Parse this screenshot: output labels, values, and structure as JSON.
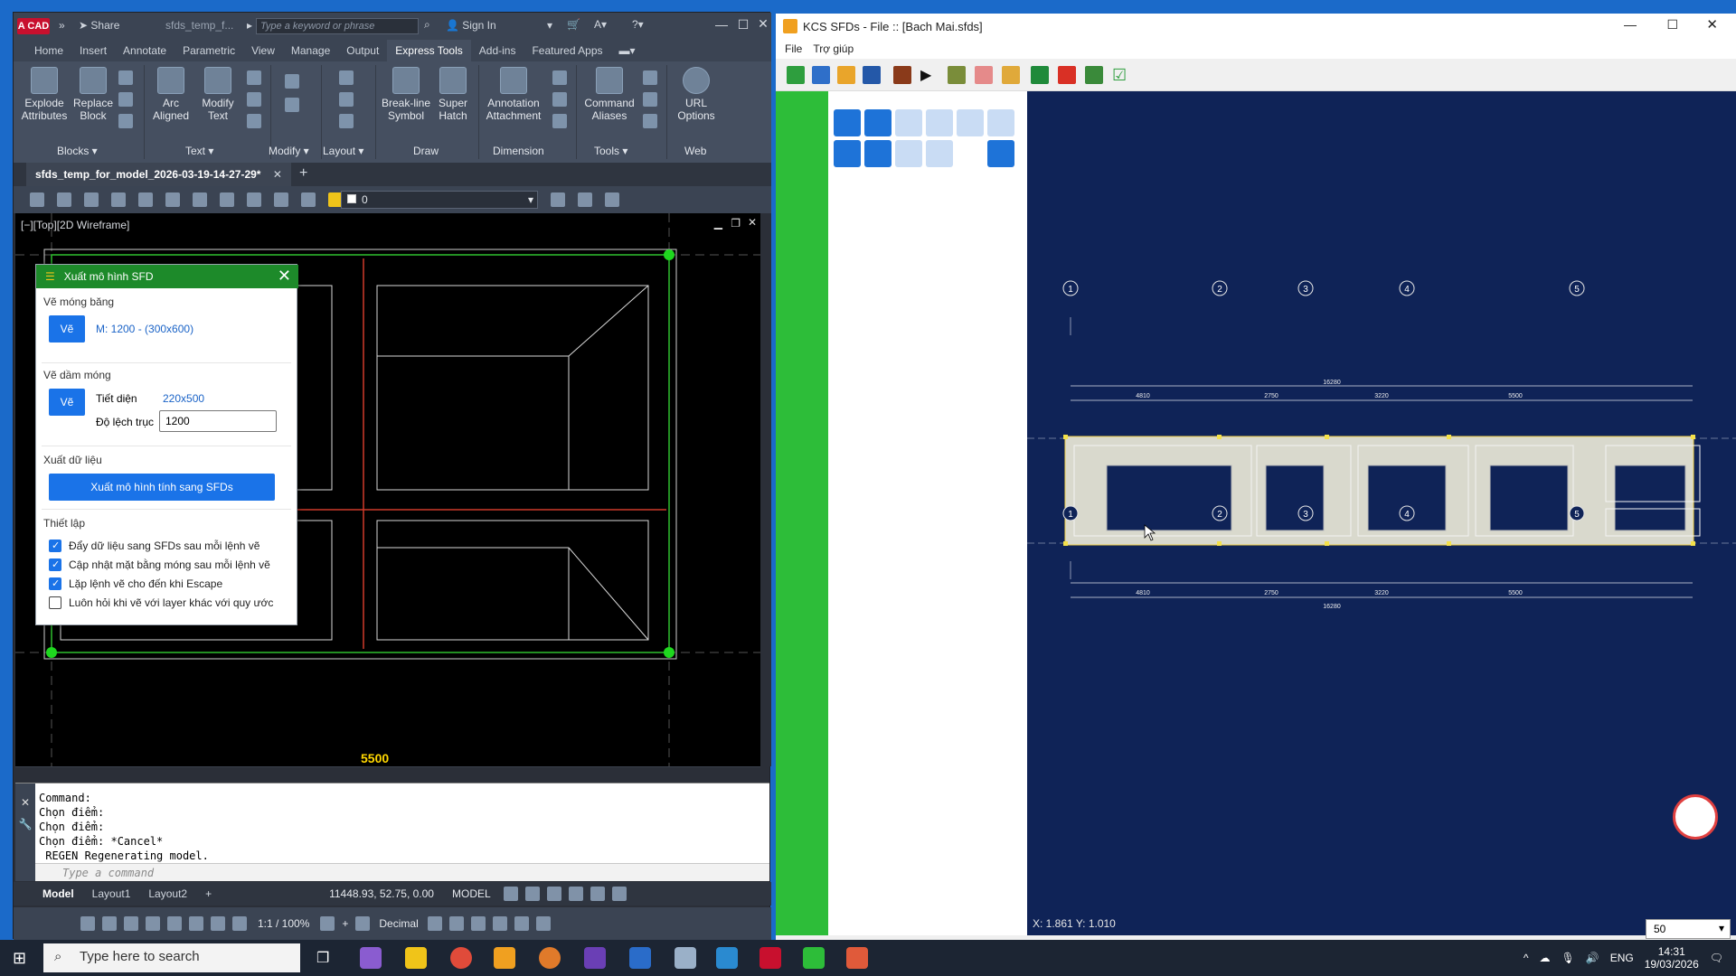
{
  "acad": {
    "title": {
      "logo": "A CAD",
      "share": "Share",
      "doc": "sfds_temp_f...",
      "search_placeholder": "Type a keyword or phrase",
      "sign_in": "Sign In"
    },
    "tabs": [
      "Home",
      "Insert",
      "Annotate",
      "Parametric",
      "View",
      "Manage",
      "Output",
      "Express Tools",
      "Add-ins",
      "Featured Apps"
    ],
    "active_tab": "Express Tools",
    "ribbon": {
      "items": [
        {
          "label1": "Explode",
          "label2": "Attributes"
        },
        {
          "label1": "Replace",
          "label2": "Block"
        },
        {
          "label1": "Arc",
          "label2": "Aligned"
        },
        {
          "label1": "Modify",
          "label2": "Text"
        },
        {
          "label1": "Break-line",
          "label2": "Symbol"
        },
        {
          "label1": "Super",
          "label2": "Hatch"
        },
        {
          "label1": "Annotation",
          "label2": "Attachment"
        },
        {
          "label1": "Command",
          "label2": "Aliases"
        },
        {
          "label1": "URL",
          "label2": "Options"
        }
      ],
      "panels": [
        "Blocks",
        "Text",
        "Modify",
        "Layout",
        "Draw",
        "Dimension",
        "Tools",
        "Web"
      ]
    },
    "doc_tab": "sfds_temp_for_model_2026-03-19-14-27-29*",
    "layer_value": "0",
    "viewport_label": "[−][Top][2D Wireframe]",
    "dimension_label": "5500",
    "command_lines": "Command:\nChọn điểm:\nChọn điểm:\nChọn điểm: *Cancel*\n REGEN Regenerating model.",
    "command_placeholder": "Type a command",
    "layout_tabs": [
      "Model",
      "Layout1",
      "Layout2"
    ],
    "status": {
      "coords": "11448.93, 52.75, 0.00",
      "model": "MODEL",
      "scale": "1:1 / 100%",
      "units": "Decimal"
    }
  },
  "dialog": {
    "title": "Xuất mô hình SFD",
    "sec1": {
      "head": "Vẽ móng băng",
      "button": "Vẽ",
      "link": "M: 1200 - (300x600)"
    },
    "sec2": {
      "head": "Vẽ dầm móng",
      "button": "Vẽ",
      "tiet_dien_label": "Tiết diện",
      "tiet_dien_value": "220x500",
      "do_lech_label": "Độ lệch trục",
      "do_lech_value": "1200"
    },
    "sec3": {
      "head": "Xuất dữ liệu",
      "button": "Xuất mô hình tính sang SFDs"
    },
    "sec4": {
      "head": "Thiết lập",
      "options": [
        {
          "label": "Đẩy dữ liệu sang SFDs sau mỗi lệnh vẽ",
          "checked": true
        },
        {
          "label": "Cập nhật mặt bằng móng sau mỗi lệnh vẽ",
          "checked": true
        },
        {
          "label": "Lặp lệnh vẽ cho đến khi Escape",
          "checked": true
        },
        {
          "label": "Luôn hỏi khi vẽ với layer khác với quy ước",
          "checked": false
        }
      ]
    }
  },
  "sfd": {
    "title": "KCS SFDs - File :: [Bach Mai.sfds]",
    "menu": [
      "File",
      "Trợ giúp"
    ],
    "axes": [
      "1",
      "2",
      "3",
      "4",
      "5"
    ],
    "dims": [
      "4810",
      "2750",
      "3220",
      "5500"
    ],
    "total_dim": "16280",
    "coords": "X: 1.861   Y: 1.010",
    "zoom": "50"
  },
  "taskbar": {
    "search": "Type here to search",
    "lang": "ENG",
    "time": "14:31",
    "date": "19/03/2026"
  },
  "colors": {
    "acad_bg": "#2b2f38",
    "dialog_green": "#1d8a2a",
    "sfd_canvas": "#0f2357",
    "sfd_green": "#2dbd39",
    "accent_blue": "#1a73e8"
  }
}
